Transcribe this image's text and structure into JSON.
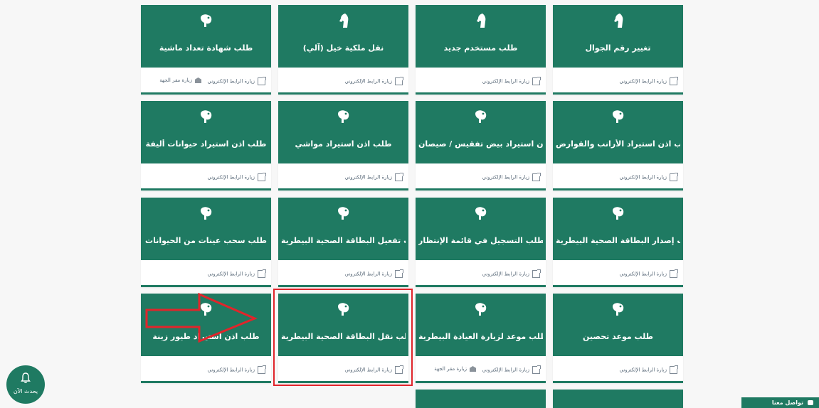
{
  "cards": [
    {
      "title": "تغيير رقم الجوال",
      "icon": "horse-icon",
      "links": [
        "زيارة الرابط الإلكتروني"
      ]
    },
    {
      "title": "طلب مستخدم جديد",
      "icon": "horse-icon",
      "links": [
        "زيارة الرابط الإلكتروني"
      ]
    },
    {
      "title": "نقل ملكية خيل (آلي)",
      "icon": "horse-icon",
      "links": [
        "زيارة الرابط الإلكتروني"
      ]
    },
    {
      "title": "طلب شهادة تعداد ماشية",
      "icon": "camel-icon",
      "links": [
        "زيارة الرابط الإلكتروني",
        "زيارة مقر الجهة"
      ]
    },
    {
      "title": "طلب اذن استيراد الأرانب والقوارض",
      "icon": "camel-icon",
      "links": [
        "زيارة الرابط الإلكتروني"
      ]
    },
    {
      "title": "طلب اذن استيراد بيض تفقيس / صيصان",
      "icon": "camel-icon",
      "links": [
        "زيارة الرابط الإلكتروني"
      ]
    },
    {
      "title": "طلب اذن استيراد مواشي",
      "icon": "camel-icon",
      "links": [
        "زيارة الرابط الإلكتروني"
      ]
    },
    {
      "title": "طلب اذن استيراد حيوانات أليفة",
      "icon": "camel-icon",
      "links": [
        "زيارة الرابط الإلكتروني"
      ]
    },
    {
      "title": "طلب إصدار البطاقة الصحية البيطرية",
      "icon": "camel-icon",
      "links": [
        "زيارة الرابط الإلكتروني"
      ]
    },
    {
      "title": "طلب التسجيل في قائمة الإنتظار",
      "icon": "camel-icon",
      "links": [
        "زيارة الرابط الإلكتروني"
      ]
    },
    {
      "title": "طلب تفعيل البطاقة الصحية البيطرية",
      "icon": "camel-icon",
      "links": [
        "زيارة الرابط الإلكتروني"
      ]
    },
    {
      "title": "طلب سحب عينات من الحيوانات",
      "icon": "camel-icon",
      "links": [
        "زيارة الرابط الإلكتروني"
      ]
    },
    {
      "title": "طلب موعد تحصين",
      "icon": "camel-icon",
      "links": [
        "زيارة الرابط الإلكتروني"
      ]
    },
    {
      "title": "طلب موعد لزيارة العيادة البيطرية",
      "icon": "camel-icon",
      "links": [
        "زيارة الرابط الإلكتروني",
        "زيارة مقر الجهة"
      ]
    },
    {
      "title": "طلب نقل البطاقة الصحية البيطرية",
      "icon": "camel-icon",
      "links": [
        "زيارة الرابط الإلكتروني"
      ]
    },
    {
      "title": "طلب اذن استيراد طيور زينة",
      "icon": "camel-icon",
      "links": [
        "زيارة الرابط الإلكتروني"
      ]
    }
  ],
  "chat_button": {
    "label": "يحدث الآن"
  },
  "contact": {
    "label": "تواصل معنا"
  },
  "colors": {
    "primary": "#1f7a62",
    "highlight": "#e0252b",
    "background": "#f7f7f7"
  }
}
